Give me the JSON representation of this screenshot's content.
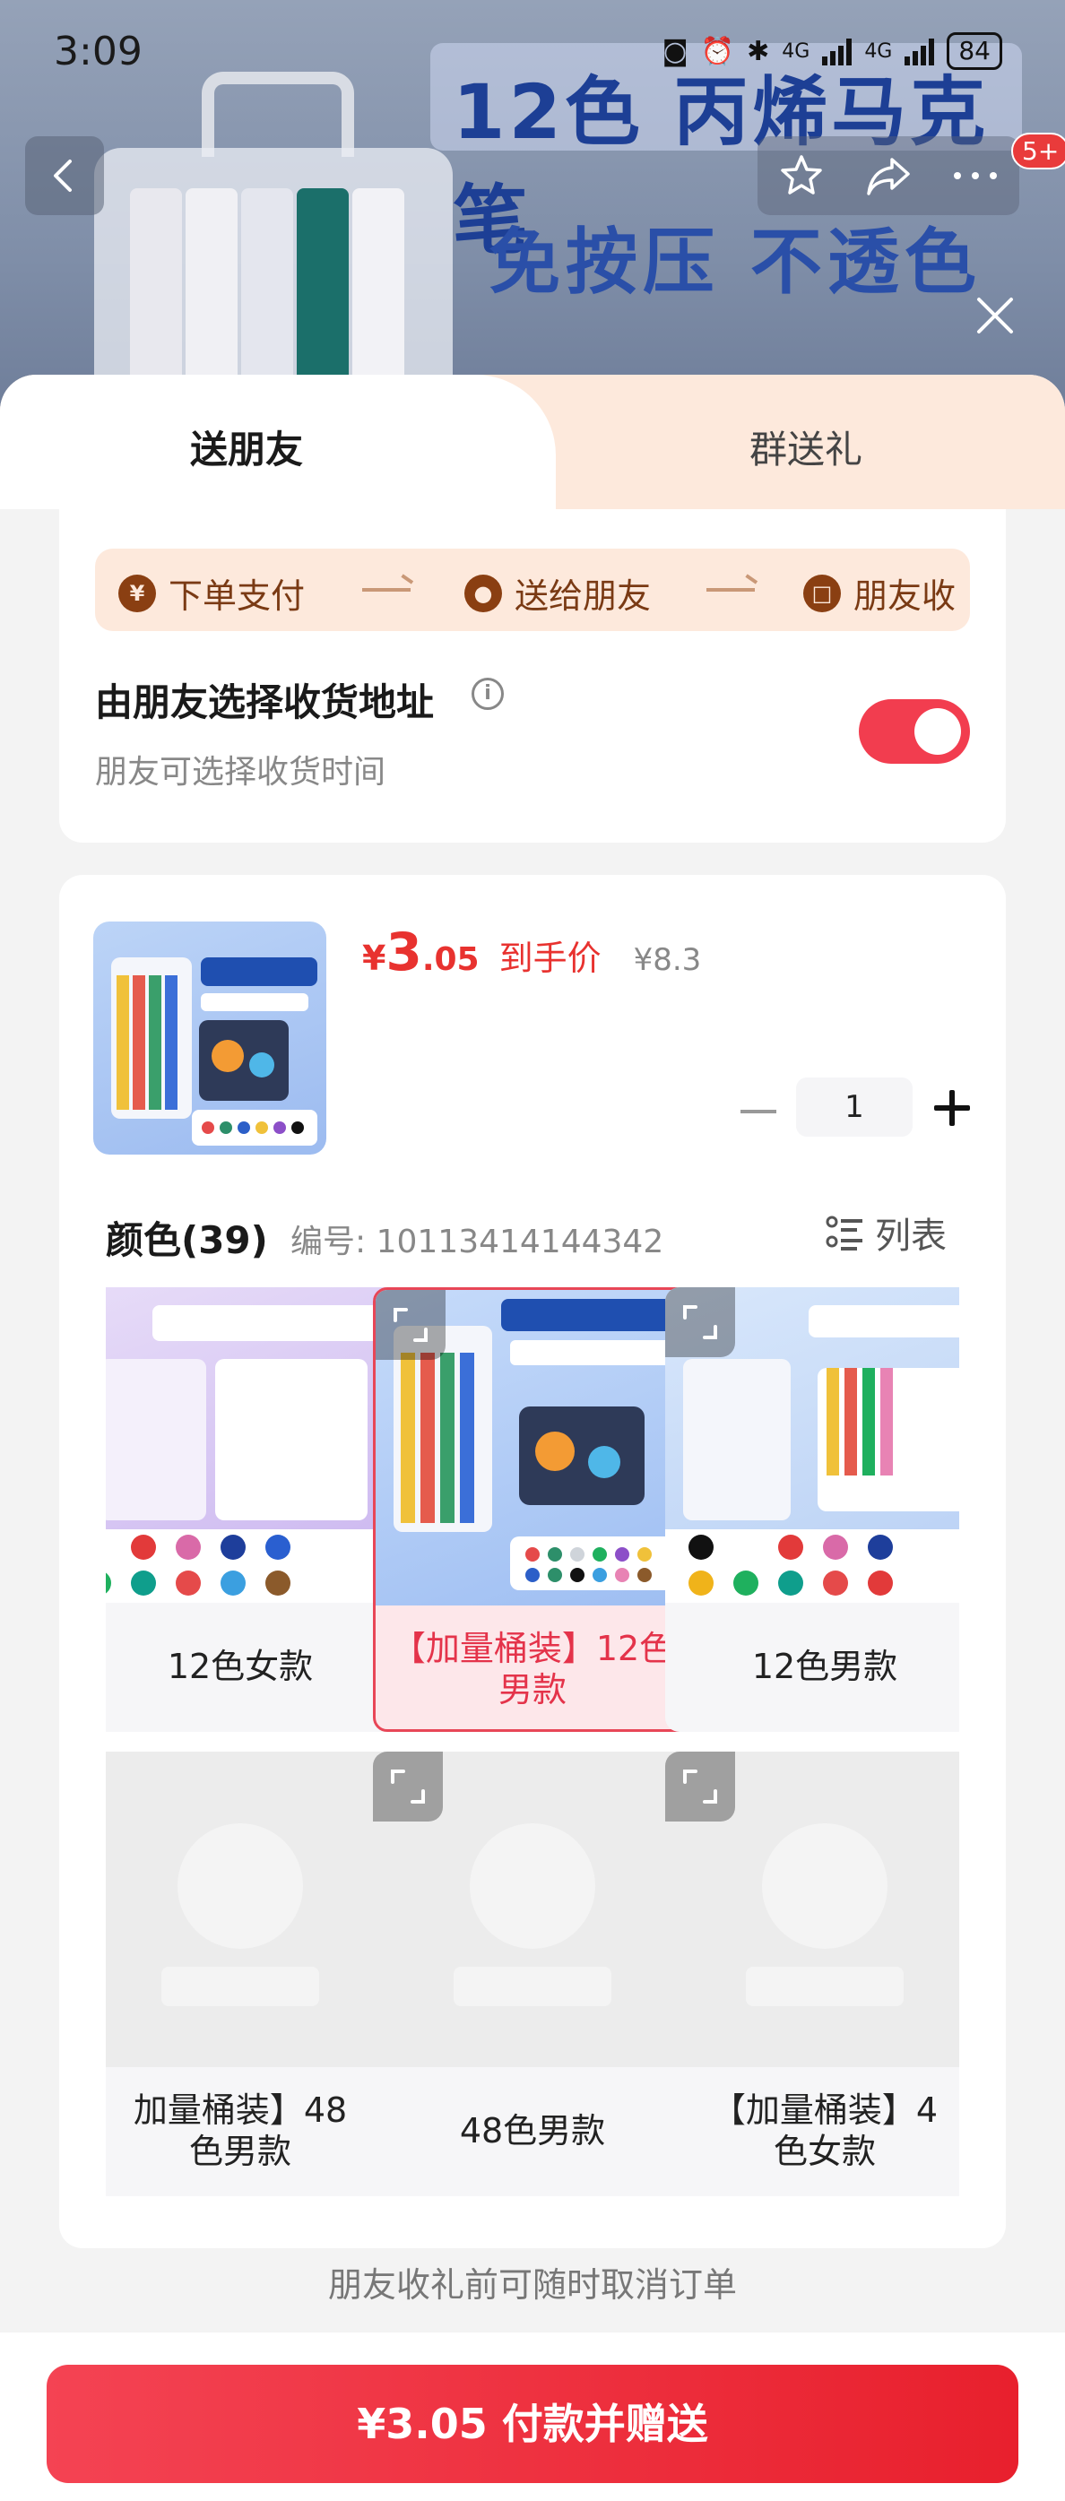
{
  "status_bar": {
    "time": "3:09",
    "network_1": "4G",
    "network_2": "4G",
    "battery": "84"
  },
  "header": {
    "badge": "5+"
  },
  "hero": {
    "title": "12色 丙烯马克笔",
    "subtitle": "免按压 不透色"
  },
  "tabs": [
    {
      "label": "送朋友",
      "active": true
    },
    {
      "label": "群送礼",
      "active": false
    }
  ],
  "flow": [
    {
      "icon": "yuan-icon",
      "label": "下单支付"
    },
    {
      "icon": "wechat-icon",
      "label": "送给朋友"
    },
    {
      "icon": "gift-icon",
      "label": "朋友收"
    }
  ],
  "address": {
    "title": "由朋友选择收货地址",
    "subtitle": "朋友可选择收货时间",
    "toggle_on": true
  },
  "product": {
    "price_symbol": "¥",
    "price_integer": "3",
    "price_decimal": ".05",
    "price_tag": "到手价",
    "original_price": "¥8.3",
    "quantity": "1"
  },
  "color_section": {
    "title": "颜色(39)",
    "sku": "编号: 10113414144342",
    "list_label": "列表"
  },
  "variants": [
    {
      "label": "12色女款",
      "selected": false
    },
    {
      "label": "【加量桶装】12色\n男款",
      "selected": true
    },
    {
      "label": "12色男款",
      "selected": false
    },
    {
      "label": "加量桶装】48\n色男款",
      "selected": false
    },
    {
      "label": "48色男款",
      "selected": false
    },
    {
      "label": "【加量桶装】4\n色女款",
      "selected": false
    }
  ],
  "footer": {
    "note": "朋友收礼前可随时取消订单",
    "pay_button": "¥3.05 付款并赠送"
  },
  "colors": {
    "accent": "#e8322f",
    "toggle": "#f23d4f",
    "tab_bg": "#fde9dc"
  }
}
